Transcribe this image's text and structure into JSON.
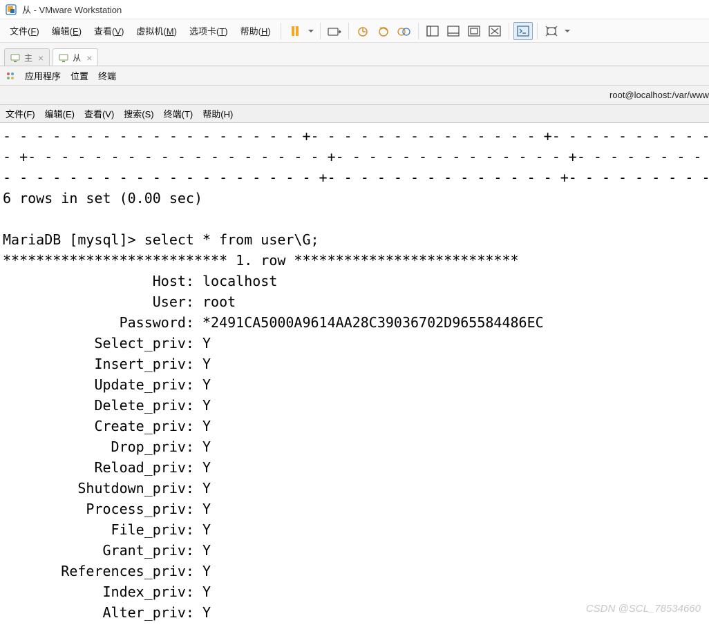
{
  "titlebar": {
    "title": "从 - VMware Workstation"
  },
  "menubar": {
    "file": {
      "text": "文件",
      "accel": "F"
    },
    "edit": {
      "text": "编辑",
      "accel": "E"
    },
    "view": {
      "text": "查看",
      "accel": "V"
    },
    "vm": {
      "text": "虚拟机",
      "accel": "M"
    },
    "tabs": {
      "text": "选项卡",
      "accel": "T"
    },
    "help": {
      "text": "帮助",
      "accel": "H"
    }
  },
  "tabs": {
    "master": "主",
    "slave": "从"
  },
  "guestbar": {
    "apps": "应用程序",
    "places": "位置",
    "terminal": "终端"
  },
  "pathbar": {
    "path": "root@localhost:/var/www"
  },
  "tmenu": {
    "file": "文件(F)",
    "edit": "编辑(E)",
    "view": "查看(V)",
    "search": "搜索(S)",
    "terminal": "终端(T)",
    "help": "帮助(H)"
  },
  "terminal_text": "- - - - - - - - - - - - - - - - - - +- - - - - - - - - - - - - - +- - - - - - - - - - - - - - +- - - - - - - - - - - - \n- +- - - - - - - - - - - - - - - - - - +- - - - - - - - - - - - - - +- - - - - - - - - - - - - - +- - - - - - - - - - - \n- - - - - - - - - - - - - - - - - - - +- - - - - - - - - - - - - - +- - - - - - - - - - - - - - +- - - - - - - - - - - - \n6 rows in set (0.00 sec)\n\nMariaDB [mysql]> select * from user\\G;\n*************************** 1. row ***************************\n                  Host: localhost\n                  User: root\n              Password: *2491CA5000A9614AA28C39036702D965584486EC\n           Select_priv: Y\n           Insert_priv: Y\n           Update_priv: Y\n           Delete_priv: Y\n           Create_priv: Y\n             Drop_priv: Y\n           Reload_priv: Y\n         Shutdown_priv: Y\n          Process_priv: Y\n             File_priv: Y\n            Grant_priv: Y\n       References_priv: Y\n            Index_priv: Y\n            Alter_priv: Y",
  "watermark": "CSDN @SCL_78534660"
}
